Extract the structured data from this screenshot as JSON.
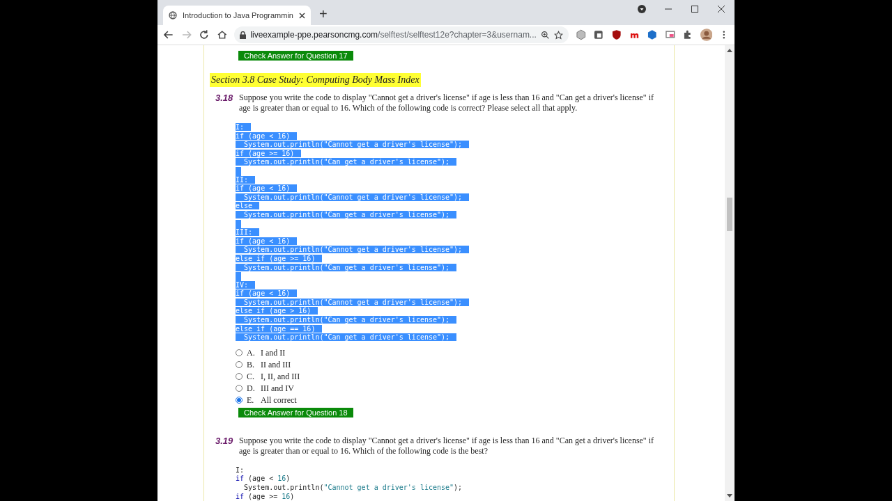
{
  "browser": {
    "tab_title": "Introduction to Java Programmin",
    "new_tab": "+",
    "url_host": "liveexample-ppe.pearsoncmg.com",
    "url_path": "/selftest/selftest12e?chapter=3&usernam..."
  },
  "prev_check_button": "Check Answer for Question 17",
  "section_title": "Section 3.8 Case Study: Computing Body Mass Index",
  "questions": [
    {
      "number": "3.18",
      "text": "Suppose you write the code to display \"Cannot get a driver's license\" if age is less than 16 and \"Can get a driver's license\" if age is greater than or equal to 16. Which of the following code is correct? Please select all that apply.",
      "code_highlighted": true,
      "code": [
        {
          "label": "I:",
          "lines": [
            [
              {
                "kind": "keyword",
                "text": "if"
              },
              {
                "kind": "plain",
                "text": " (age < 16)"
              }
            ],
            [
              {
                "kind": "plain",
                "text": "  System.out.println(\"Cannot get a driver's license\");"
              }
            ],
            [
              {
                "kind": "keyword",
                "text": "if"
              },
              {
                "kind": "plain",
                "text": " (age >= 16)"
              }
            ],
            [
              {
                "kind": "plain",
                "text": "  System.out.println(\"Can get a driver's license\");"
              }
            ]
          ]
        },
        {
          "label": "II:",
          "lines": [
            [
              {
                "kind": "keyword",
                "text": "if"
              },
              {
                "kind": "plain",
                "text": " (age < 16)"
              }
            ],
            [
              {
                "kind": "plain",
                "text": "  System.out.println(\"Cannot get a driver's license\");"
              }
            ],
            [
              {
                "kind": "keyword",
                "text": "else"
              }
            ],
            [
              {
                "kind": "plain",
                "text": "  System.out.println(\"Can get a driver's license\");"
              }
            ]
          ]
        },
        {
          "label": "III:",
          "lines": [
            [
              {
                "kind": "keyword",
                "text": "if"
              },
              {
                "kind": "plain",
                "text": " (age < 16)"
              }
            ],
            [
              {
                "kind": "plain",
                "text": "  System.out.println(\"Cannot get a driver's license\");"
              }
            ],
            [
              {
                "kind": "keyword",
                "text": "else if"
              },
              {
                "kind": "plain",
                "text": " (age >= 16)"
              }
            ],
            [
              {
                "kind": "plain",
                "text": "  System.out.println(\"Can get a driver's license\");"
              }
            ]
          ]
        },
        {
          "label": "IV:",
          "lines": [
            [
              {
                "kind": "keyword",
                "text": "if"
              },
              {
                "kind": "plain",
                "text": " (age < 16)"
              }
            ],
            [
              {
                "kind": "plain",
                "text": "  System.out.println(\"Cannot get a driver's license\");"
              }
            ],
            [
              {
                "kind": "keyword",
                "text": "else if"
              },
              {
                "kind": "plain",
                "text": " (age > 16)"
              }
            ],
            [
              {
                "kind": "plain",
                "text": "  System.out.println(\"Can get a driver's license\");"
              }
            ],
            [
              {
                "kind": "keyword",
                "text": "else if"
              },
              {
                "kind": "plain",
                "text": " (age == 16)"
              }
            ],
            [
              {
                "kind": "plain",
                "text": "  System.out.println(\"Can get a driver's license\");"
              }
            ]
          ]
        }
      ],
      "options": [
        {
          "letter": "A.",
          "text": "I and II",
          "selected": false
        },
        {
          "letter": "B.",
          "text": "II and III",
          "selected": false
        },
        {
          "letter": "C.",
          "text": "I, II, and III",
          "selected": false
        },
        {
          "letter": "D.",
          "text": "III and IV",
          "selected": false
        },
        {
          "letter": "E.",
          "text": "All correct",
          "selected": true
        }
      ],
      "check_button": "Check Answer for Question 18"
    },
    {
      "number": "3.19",
      "text": "Suppose you write the code to display \"Cannot get a driver's license\" if age is less than 16 and \"Can get a driver's license\" if age is greater than or equal to 16. Which of the following code is the best?",
      "code_highlighted": false,
      "code": [
        {
          "label": "I:",
          "lines": [
            [
              {
                "kind": "keyword",
                "text": "if"
              },
              {
                "kind": "plain",
                "text": " (age < "
              },
              {
                "kind": "literal",
                "text": "16"
              },
              {
                "kind": "plain",
                "text": ")"
              }
            ],
            [
              {
                "kind": "plain",
                "text": "  System.out.println("
              },
              {
                "kind": "literal",
                "text": "\"Cannot get a driver's license\""
              },
              {
                "kind": "plain",
                "text": ");"
              }
            ],
            [
              {
                "kind": "keyword",
                "text": "if"
              },
              {
                "kind": "plain",
                "text": " (age >= "
              },
              {
                "kind": "literal",
                "text": "16"
              },
              {
                "kind": "plain",
                "text": ")"
              }
            ]
          ]
        }
      ]
    }
  ]
}
